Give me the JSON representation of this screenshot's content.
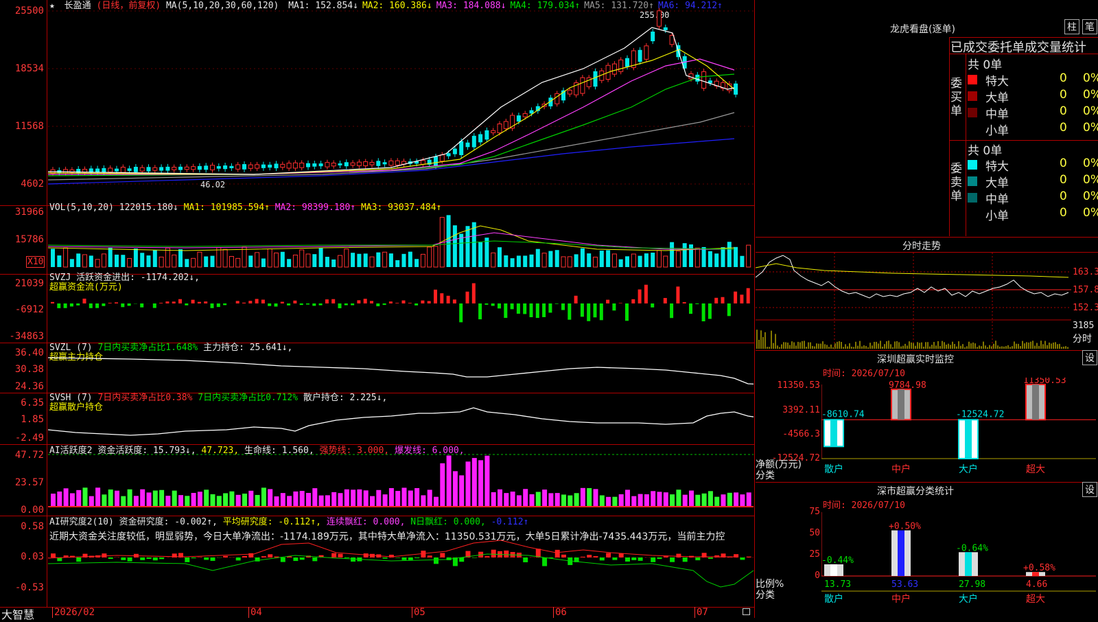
{
  "header": {
    "star": "★",
    "stock": "长盈通",
    "mode": "(日线，前复权)",
    "ma_label": "MA(5,10,20,30,60,120)",
    "ma": [
      {
        "name": "MA1:",
        "value": "152.854↓",
        "color": "#e8e8e8"
      },
      {
        "name": "MA2:",
        "value": "160.386↓",
        "color": "#f5f500"
      },
      {
        "name": "MA3:",
        "value": "184.088↓",
        "color": "#ff40ff"
      },
      {
        "name": "MA4:",
        "value": "179.034↑",
        "color": "#00e000"
      },
      {
        "name": "MA5:",
        "value": "131.720↑",
        "color": "#9a9a9a"
      },
      {
        "name": "MA6:",
        "value": "94.212↑",
        "color": "#3030ff"
      }
    ],
    "high_marker": "255.00",
    "low_marker": "46.02"
  },
  "price_axis": [
    "25500",
    "18534",
    "11568",
    "4602"
  ],
  "vol": {
    "label": "VOL(5,10,20)",
    "value": "122015.180↓",
    "ma1": "MA1: 101985.594↑",
    "ma2": "MA2: 98399.180↑",
    "ma3": "MA3: 93037.484↑",
    "axis": [
      "31966",
      "15786"
    ],
    "unit": "X10"
  },
  "svzj": {
    "label": "SVZJ  活跃资金进出:",
    "value": "-1174.202↓,",
    "sub": "超赢资金流(万元)",
    "axis": [
      "21039",
      "-6912",
      "-34863"
    ]
  },
  "svzl": {
    "label": "SVZL (7)",
    "p1": "7日内买卖净占比1.648%",
    "p2": "主力持仓: 25.641↓,",
    "sub": "超赢主力持仓",
    "axis": [
      "36.40",
      "30.38",
      "24.36"
    ]
  },
  "svsh": {
    "label": "SVSH (7)",
    "p1": "7日内买卖净占比0.38%",
    "p2": "7日内买卖净占比0.712%",
    "p3": "散户持仓: 2.225↓,",
    "sub": "超赢散户持仓",
    "axis": [
      "6.35",
      "1.85",
      "-2.49"
    ]
  },
  "ai_active": {
    "label": "AI活跃度2",
    "p1": "资金活跃度: 15.793↓,",
    "p2": "47.723,",
    "p3": "生命线: 1.560,",
    "p4": "强势线: 3.000,",
    "p5": "爆发线: 6.000,",
    "axis": [
      "47.72",
      "23.57",
      "0.00"
    ]
  },
  "ai_research": {
    "label": "AI研究度2(10)",
    "p1": "资金研究度: -0.002↑,",
    "p2": "平均研究度: -0.112↑,",
    "p3": "连续飘红: 0.000,",
    "p4": "N日飘红: 0.000,",
    "p5": "-0.112↑",
    "desc": "近期大资金关注度较低，明显弱势，今日大单净流出：-1174.189万元，其中特大单净流入：11350.531万元，大单5日累计净出-7435.443万元，当前主力控",
    "axis": [
      "0.58",
      "0.03",
      "-0.53"
    ]
  },
  "xaxis": {
    "brand": "大智慧",
    "labels": [
      "2026/02",
      "04",
      "05",
      "06",
      "07"
    ]
  },
  "lhb": {
    "title": "龙虎看盘(逐单)",
    "btn1": "柱",
    "btn2": "笔",
    "subtitle": "已成交委托单成交量统计",
    "buy_label": "委买单",
    "sell_label": "委卖单",
    "buy_total": "共 0单",
    "sell_total": "共 0单",
    "buy_rows": [
      {
        "name": "特大",
        "count": "0",
        "pct": "0%",
        "color": "#ff1010"
      },
      {
        "name": "大单",
        "count": "0",
        "pct": "0%",
        "color": "#a00000"
      },
      {
        "name": "中单",
        "count": "0",
        "pct": "0%",
        "color": "#700000"
      },
      {
        "name": "小单",
        "count": "0",
        "pct": "0%",
        "color": ""
      }
    ],
    "sell_rows": [
      {
        "name": "特大",
        "count": "0",
        "pct": "0%",
        "color": "#00f0f0"
      },
      {
        "name": "大单",
        "count": "0",
        "pct": "0%",
        "color": "#008888"
      },
      {
        "name": "中单",
        "count": "0",
        "pct": "0%",
        "color": "#006868"
      },
      {
        "name": "小单",
        "count": "0",
        "pct": "0%",
        "color": ""
      }
    ]
  },
  "intraday": {
    "title": "分时走势",
    "axis": [
      "163.3",
      "157.8",
      "152.3",
      "3185"
    ],
    "unit": "分时"
  },
  "sz_monitor": {
    "title": "深圳超赢实时监控",
    "btn": "设",
    "time_label": "时间: 2026/07/10",
    "axis": [
      "11350.53",
      "3392.11",
      "-4566.3",
      "-12524.72"
    ],
    "ylabel": "净额(万元)",
    "xlabel": "分类",
    "categories": [
      "散户",
      "中户",
      "大户",
      "超大"
    ],
    "values": [
      "-8610.74",
      "9784.98",
      "-12524.72",
      "11350.53"
    ]
  },
  "sz_stats": {
    "title": "深市超赢分类统计",
    "btn": "设",
    "time_label": "时间: 2026/07/10",
    "axis": [
      "75",
      "50",
      "25",
      "0"
    ],
    "ylabel": "比例%",
    "xlabel": "分类",
    "categories": [
      "散户",
      "中户",
      "大户",
      "超大"
    ],
    "values": [
      "13.73",
      "53.63",
      "27.98",
      "4.66"
    ],
    "changes": [
      "-0.44%",
      "+0.50%",
      "-0.64%",
      "+0.58%"
    ]
  }
}
